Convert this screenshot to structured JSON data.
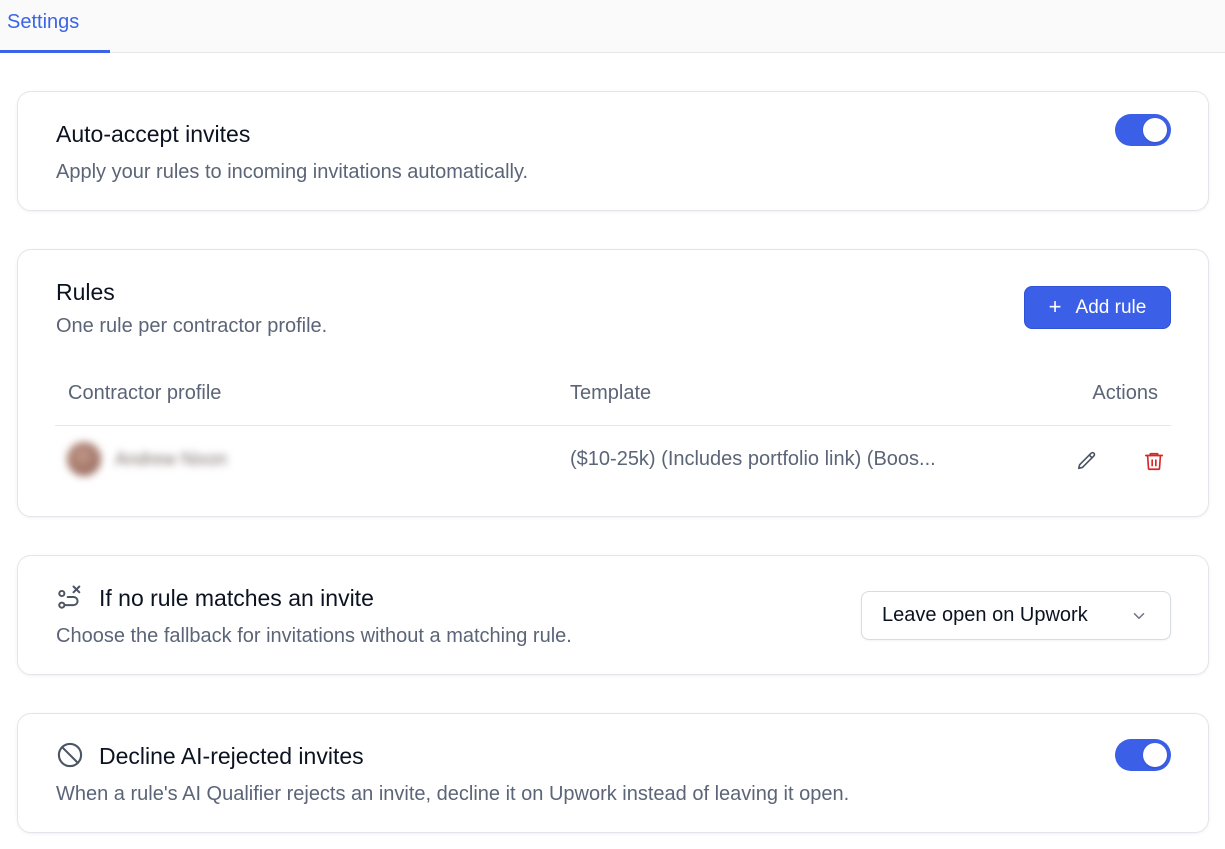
{
  "tabs": [
    {
      "label": "Settings",
      "active": true
    }
  ],
  "auto_accept": {
    "title": "Auto-accept invites",
    "description": "Apply your rules to incoming invitations automatically.",
    "enabled": true
  },
  "rules": {
    "title": "Rules",
    "description": "One rule per contractor profile.",
    "add_button_label": "Add rule",
    "columns": {
      "profile": "Contractor profile",
      "template": "Template",
      "actions": "Actions"
    },
    "rows": [
      {
        "profile_name": "Andrew Nixon",
        "template": "($10-25k) (Includes portfolio link) (Boos...",
        "edit_icon": "pencil-icon",
        "delete_icon": "trash-icon"
      }
    ]
  },
  "fallback": {
    "icon": "route-off-icon",
    "title": "If no rule matches an invite",
    "description": "Choose the fallback for invitations without a matching rule.",
    "selected": "Leave open on Upwork"
  },
  "decline": {
    "icon": "ban-icon",
    "title": "Decline AI-rejected invites",
    "description": "When a rule's AI Qualifier rejects an invite, decline it on Upwork instead of leaving it open.",
    "enabled": true
  },
  "colors": {
    "accent": "#3b5fe6",
    "danger": "#dc2626",
    "muted_text": "#5b6577"
  }
}
